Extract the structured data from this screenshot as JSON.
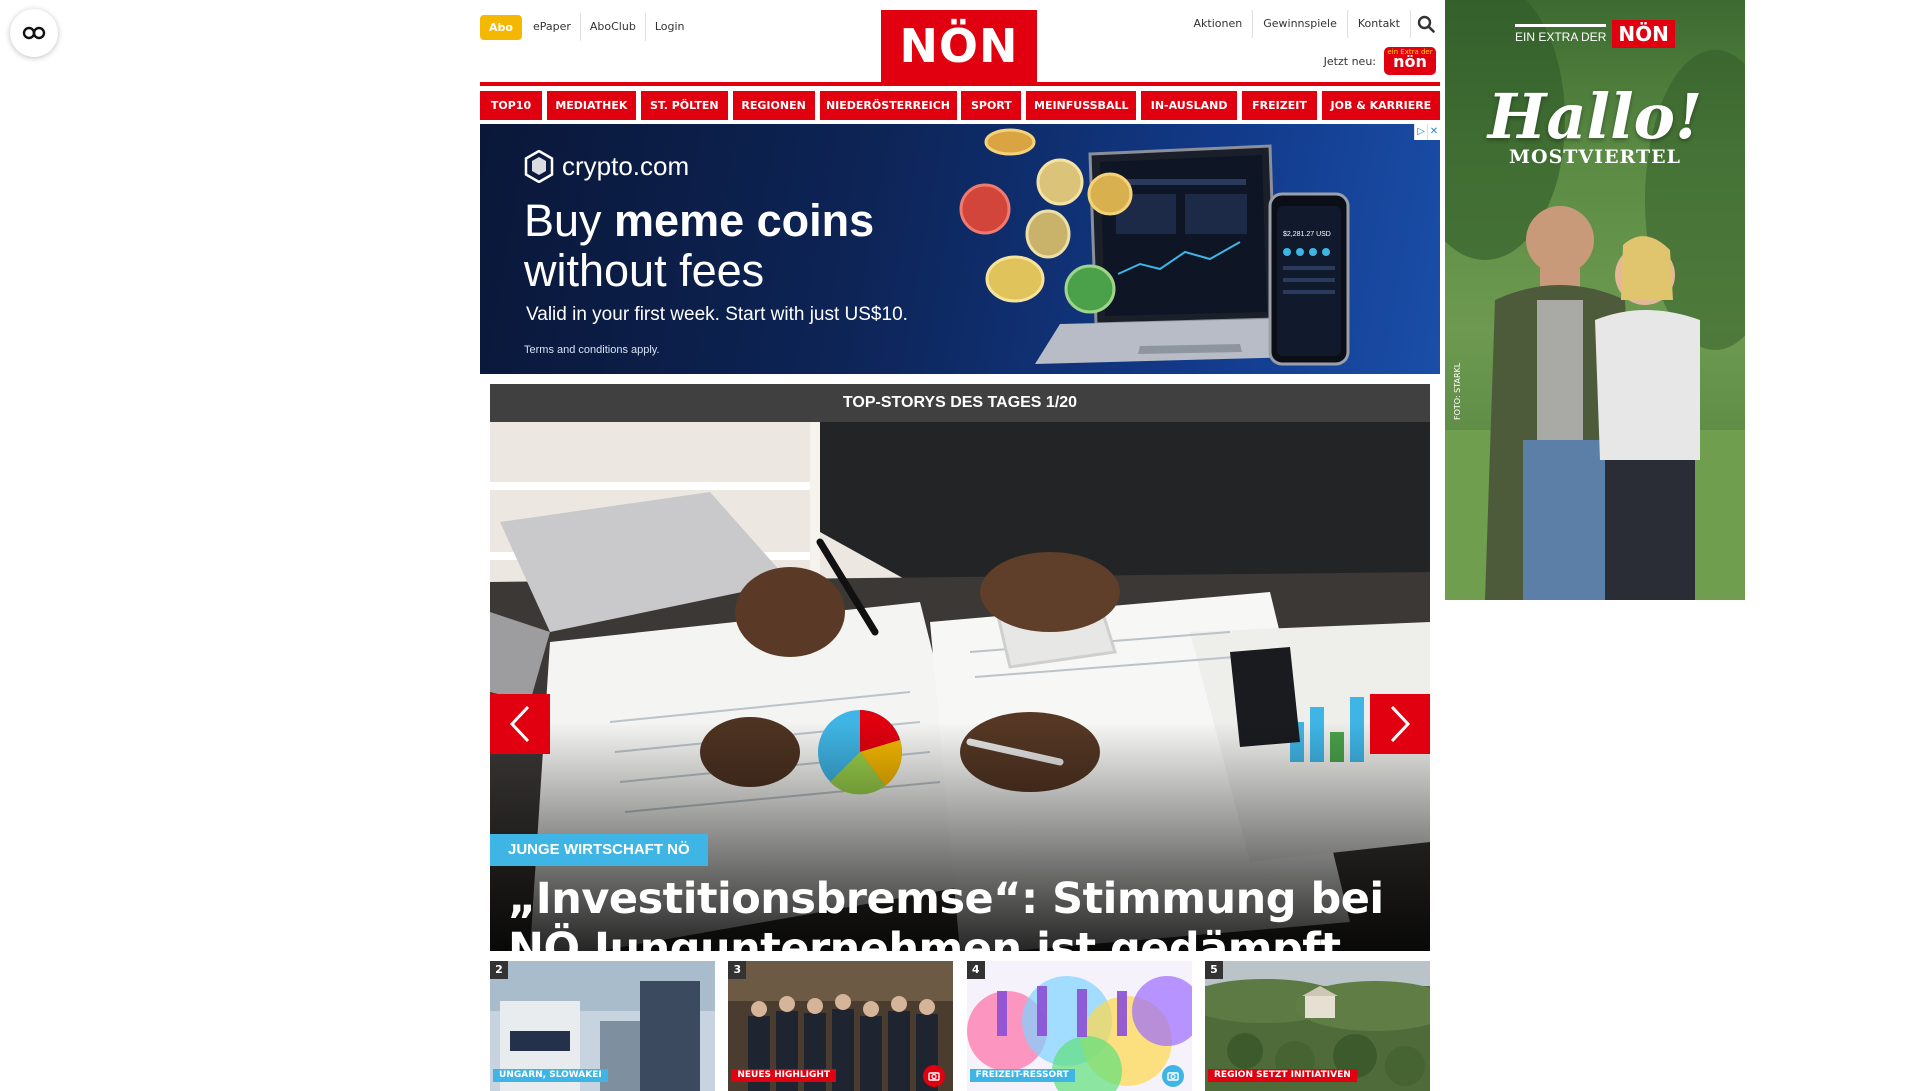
{
  "header": {
    "abo_label": "Abo",
    "left_links": [
      "ePaper",
      "AboClub",
      "Login"
    ],
    "logo_text": "NÖN",
    "right_links": [
      "Aktionen",
      "Gewinnspiele",
      "Kontakt"
    ],
    "jetzt_label": "Jetzt neu:",
    "mini_logo_small": "ein Extra der",
    "mini_logo_text": "nön"
  },
  "categories": [
    "TOP10",
    "MEDIATHEK",
    "ST. PÖLTEN",
    "REGIONEN",
    "NIEDERÖSTERREICH",
    "SPORT",
    "MEINFUSSBALL",
    "IN-AUSLAND",
    "FREIZEIT",
    "JOB & KARRIERE"
  ],
  "ad": {
    "brand": "crypto.com",
    "headline_plain": "Buy ",
    "headline_bold": "meme coins",
    "headline_line2": "without fees",
    "subline": "Valid in your first week. Start with just US$10.",
    "terms": "Terms and conditions apply.",
    "phone_amount": "$2,281.27 USD"
  },
  "hero": {
    "heading": "TOP-STORYS DES TAGES 1/20",
    "tag": "JUNGE WIRTSCHAFT NÖ",
    "title": "„Investitionsbremse“: Stimmung bei NÖ Jungunternehmen ist gedämpft"
  },
  "tiles": [
    {
      "num": "2",
      "tag": "UNGARN, SLOWAKEI",
      "tag_color": "#3fb5e5",
      "camera": false
    },
    {
      "num": "3",
      "tag": "NEUES HIGHLIGHT",
      "tag_color": "#e1000f",
      "camera": true,
      "camera_color": "#e1000f"
    },
    {
      "num": "4",
      "tag": "FREIZEIT-RESSORT",
      "tag_color": "#3fb5e5",
      "camera": true,
      "camera_color": "#3fb5e5"
    },
    {
      "num": "5",
      "tag": "REGION SETZT INITIATIVEN",
      "tag_color": "#e1000f",
      "camera": false
    }
  ],
  "side_ad": {
    "extra": "EIN EXTRA DER",
    "logo": "NÖN",
    "hallo": "Hallo!",
    "region": "MOSTVIERTEL",
    "credit": "FOTO: STARKL"
  },
  "colors": {
    "brand_red": "#e1000f",
    "abo_yellow": "#f5b800",
    "tag_blue": "#3fb5e5"
  }
}
